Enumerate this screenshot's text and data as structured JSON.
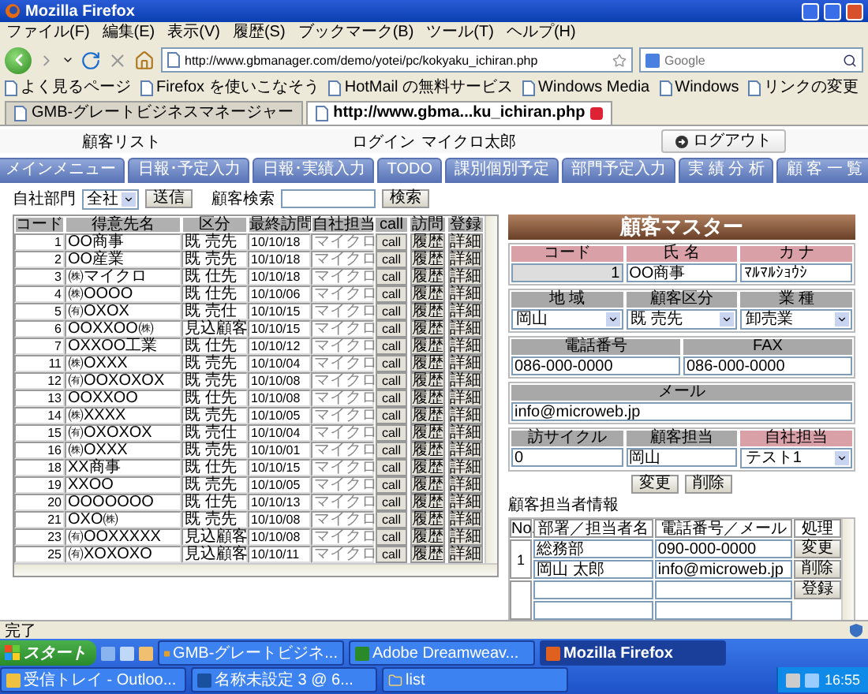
{
  "browser": {
    "title": "Mozilla Firefox",
    "menu": [
      "ファイル(F)",
      "編集(E)",
      "表示(V)",
      "履歴(S)",
      "ブックマーク(B)",
      "ツール(T)",
      "ヘルプ(H)"
    ],
    "url": "http://www.gbmanager.com/demo/yotei/pc/kokyaku_ichiran.php",
    "search_placeholder": "Google",
    "bookmarks": [
      "よく見るページ",
      "Firefox を使いこなそう",
      "HotMail の無料サービス",
      "Windows Media",
      "Windows",
      "リンクの変更"
    ],
    "tabs": [
      {
        "label": "GMB-グレートビジネスマネージャー",
        "selected": false
      },
      {
        "label": "http://www.gbma...ku_ichiran.php",
        "selected": true
      }
    ]
  },
  "page": {
    "title": "顧客リスト",
    "login_label": "ログイン",
    "user": "マイクロ太郎",
    "logout": "ログアウト"
  },
  "nav": [
    "メインメニュー",
    "日報･予定入力",
    "日報･実績入力",
    "TODO",
    "課別個別予定",
    "部門予定入力",
    "実 績 分 析",
    "顧 客 一 覧"
  ],
  "filter": {
    "dept_label": "自社部門",
    "dept_value": "全社",
    "send": "送信",
    "search_label": "顧客検索",
    "search_button": "検索"
  },
  "table": {
    "columns": [
      "コード",
      "得意先名",
      "区分",
      "最終訪問",
      "自社担当",
      "call",
      "訪問",
      "登録"
    ],
    "rows": [
      {
        "code": "1",
        "name": "OO商事",
        "category": "既 売先",
        "last_visit": "10/10/18",
        "staff": "マイクロ",
        "buttons": [
          "call",
          "履歴",
          "詳細"
        ]
      },
      {
        "code": "2",
        "name": "OO産業",
        "category": "既 売先",
        "last_visit": "10/10/18",
        "staff": "マイクロ",
        "buttons": [
          "call",
          "履歴",
          "詳細"
        ]
      },
      {
        "code": "3",
        "name": "㈱マイクロ",
        "category": "既 仕先",
        "last_visit": "10/10/18",
        "staff": "マイクロ",
        "buttons": [
          "call",
          "履歴",
          "詳細"
        ]
      },
      {
        "code": "4",
        "name": "㈱OOOO",
        "category": "既 仕先",
        "last_visit": "10/10/06",
        "staff": "マイクロ",
        "buttons": [
          "call",
          "履歴",
          "詳細"
        ]
      },
      {
        "code": "5",
        "name": "㈲OXOX",
        "category": "既 売仕",
        "last_visit": "10/10/15",
        "staff": "マイクロ",
        "buttons": [
          "call",
          "履歴",
          "詳細"
        ]
      },
      {
        "code": "6",
        "name": "OOXXOO㈱",
        "category": "見込顧客",
        "last_visit": "10/10/15",
        "staff": "マイクロ",
        "buttons": [
          "call",
          "履歴",
          "詳細"
        ]
      },
      {
        "code": "7",
        "name": "OXXOO工業",
        "category": "既 仕先",
        "last_visit": "10/10/12",
        "staff": "マイクロ",
        "buttons": [
          "call",
          "履歴",
          "詳細"
        ]
      },
      {
        "code": "11",
        "name": "㈱OXXX",
        "category": "既 売先",
        "last_visit": "10/10/04",
        "staff": "マイクロ",
        "buttons": [
          "call",
          "履歴",
          "詳細"
        ]
      },
      {
        "code": "12",
        "name": "㈲OOXOXOX",
        "category": "既 売先",
        "last_visit": "10/10/08",
        "staff": "マイクロ",
        "buttons": [
          "call",
          "履歴",
          "詳細"
        ]
      },
      {
        "code": "13",
        "name": "OOXXOO",
        "category": "既 仕先",
        "last_visit": "10/10/08",
        "staff": "マイクロ",
        "buttons": [
          "call",
          "履歴",
          "詳細"
        ]
      },
      {
        "code": "14",
        "name": "㈱XXXX",
        "category": "既 売先",
        "last_visit": "10/10/05",
        "staff": "マイクロ",
        "buttons": [
          "call",
          "履歴",
          "詳細"
        ]
      },
      {
        "code": "15",
        "name": "㈲OXOXOX",
        "category": "既 売仕",
        "last_visit": "10/10/04",
        "staff": "マイクロ",
        "buttons": [
          "call",
          "履歴",
          "詳細"
        ]
      },
      {
        "code": "16",
        "name": "㈱OXXX",
        "category": "既 売先",
        "last_visit": "10/10/01",
        "staff": "マイクロ",
        "buttons": [
          "call",
          "履歴",
          "詳細"
        ]
      },
      {
        "code": "18",
        "name": "XX商事",
        "category": "既 仕先",
        "last_visit": "10/10/15",
        "staff": "マイクロ",
        "buttons": [
          "call",
          "履歴",
          "詳細"
        ]
      },
      {
        "code": "19",
        "name": "XXOO",
        "category": "既 売先",
        "last_visit": "10/10/05",
        "staff": "マイクロ",
        "buttons": [
          "call",
          "履歴",
          "詳細"
        ]
      },
      {
        "code": "20",
        "name": "OOOOOOO",
        "category": "既 仕先",
        "last_visit": "10/10/13",
        "staff": "マイクロ",
        "buttons": [
          "call",
          "履歴",
          "詳細"
        ]
      },
      {
        "code": "21",
        "name": "OXO㈱",
        "category": "既 売先",
        "last_visit": "10/10/08",
        "staff": "マイクロ",
        "buttons": [
          "call",
          "履歴",
          "詳細"
        ]
      },
      {
        "code": "23",
        "name": "㈲OOXXXXX",
        "category": "見込顧客",
        "last_visit": "10/10/08",
        "staff": "マイクロ",
        "buttons": [
          "call",
          "履歴",
          "詳細"
        ]
      },
      {
        "code": "25",
        "name": "㈲XOXOXO",
        "category": "見込顧客",
        "last_visit": "10/10/11",
        "staff": "マイクロ",
        "buttons": [
          "call",
          "履歴",
          "詳細"
        ]
      }
    ]
  },
  "master": {
    "title": "顧客マスター",
    "sections": [
      {
        "fields": [
          {
            "label": "コード",
            "color": "#d9a0a8",
            "value": "1",
            "kind": "readonly"
          },
          {
            "label": "氏 名",
            "color": "#d9a0a8",
            "value": "OO商事",
            "kind": "text"
          },
          {
            "label": "カ ナ",
            "color": "#d9a0a8",
            "value": "ﾏﾙﾏﾙｼｮｳｼ",
            "kind": "text"
          }
        ]
      },
      {
        "fields": [
          {
            "label": "地 域",
            "color": "#a8a8a8",
            "value": "岡山",
            "kind": "select"
          },
          {
            "label": "顧客区分",
            "color": "#a8a8a8",
            "value": "既 売先",
            "kind": "select"
          },
          {
            "label": "業 種",
            "color": "#a8a8a8",
            "value": "卸売業",
            "kind": "select"
          }
        ]
      },
      {
        "fields": [
          {
            "label": "電話番号",
            "color": "#a8a8a8",
            "value": "086-000-0000",
            "kind": "text"
          },
          {
            "label": "FAX",
            "color": "#a8a8a8",
            "value": "086-000-0000",
            "kind": "text"
          }
        ]
      },
      {
        "fields": [
          {
            "label": "メール",
            "color": "#a8a8a8",
            "value": "info@microweb.jp",
            "kind": "text"
          }
        ]
      },
      {
        "fields": [
          {
            "label": "訪サイクル",
            "color": "#a8a8a8",
            "value": "0",
            "kind": "text"
          },
          {
            "label": "顧客担当",
            "color": "#a8a8a8",
            "value": "岡山",
            "kind": "text"
          },
          {
            "label": "自社担当",
            "color": "#d9a0a8",
            "value": "テスト1",
            "kind": "select"
          }
        ]
      }
    ],
    "buttons": [
      "変更",
      "削除"
    ]
  },
  "contacts": {
    "title": "顧客担当者情報",
    "columns": [
      "No.",
      "部署／担当者名",
      "電話番号／メール",
      "処理"
    ],
    "rows": [
      {
        "no": "1",
        "dept": "総務部",
        "name": "岡山 太郎",
        "phone": "090-000-0000",
        "mail": "info@microweb.jp",
        "buttons": [
          "変更",
          "削除"
        ]
      },
      {
        "buttons": [
          "登録"
        ]
      }
    ]
  },
  "status_bar": "完了",
  "taskbar": {
    "start": "スタート",
    "items": [
      {
        "label": "GMB-グレートビジネ...",
        "selected": false
      },
      {
        "label": "Adobe Dreamweav...",
        "selected": false
      },
      {
        "label": "Mozilla Firefox",
        "selected": true
      },
      {
        "label": "受信トレイ - Outloo...",
        "selected": false
      },
      {
        "label": "名称未設定 3 @ 6...",
        "selected": false
      },
      {
        "label": "list",
        "selected": false
      }
    ],
    "clock": "16:55"
  }
}
